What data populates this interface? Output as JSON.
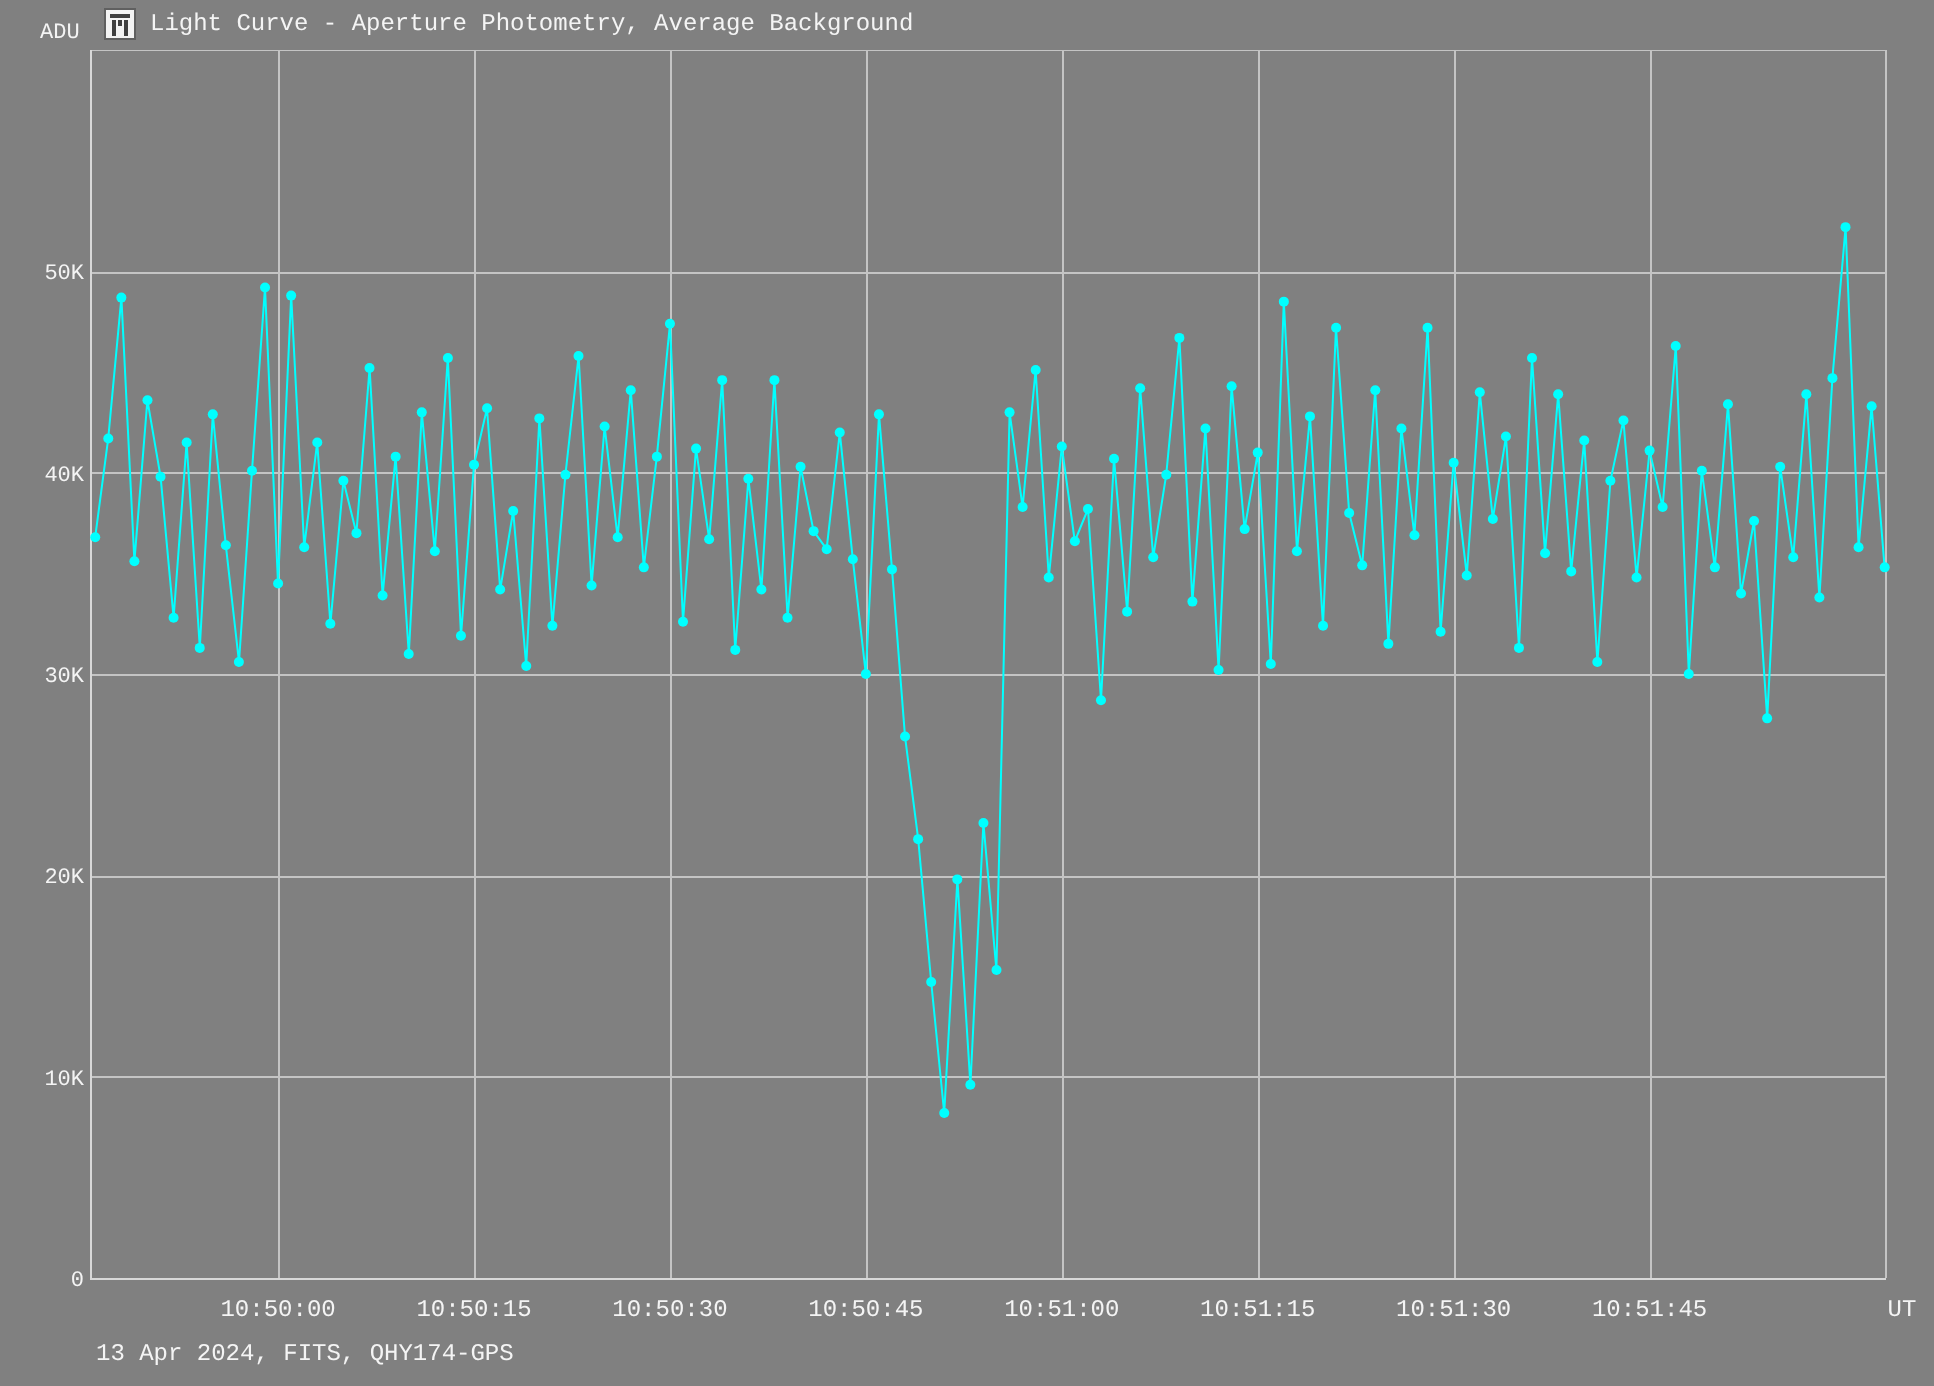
{
  "window": {
    "title": "Light Curve - Aperture Photometry, Average Background"
  },
  "chart": {
    "chart_data": {
      "type": "line",
      "xlabel": "UT",
      "ylabel": "ADU",
      "categories": [
        null,
        null,
        null,
        null,
        null,
        null,
        null,
        null,
        null,
        null,
        null,
        null,
        null,
        null,
        "10:50:00",
        null,
        null,
        null,
        null,
        null,
        null,
        null,
        null,
        null,
        null,
        null,
        null,
        null,
        null,
        "10:50:15",
        null,
        null,
        null,
        null,
        null,
        null,
        null,
        null,
        null,
        null,
        null,
        null,
        null,
        null,
        "10:50:30",
        null,
        null,
        null,
        null,
        null,
        null,
        null,
        null,
        null,
        null,
        null,
        null,
        null,
        null,
        "10:50:45",
        null,
        null,
        null,
        null,
        null,
        null,
        null,
        null,
        null,
        null,
        null,
        null,
        null,
        null,
        "10:51:00",
        null,
        null,
        null,
        null,
        null,
        null,
        null,
        null,
        null,
        null,
        null,
        null,
        null,
        null,
        "10:51:15",
        null,
        null,
        null,
        null,
        null,
        null,
        null,
        null,
        null,
        null,
        null,
        null,
        null,
        null,
        "10:51:30",
        null,
        null,
        null,
        null,
        null,
        null,
        null,
        null,
        null,
        null,
        null,
        null,
        null,
        null,
        "10:51:45",
        null,
        null,
        null,
        null,
        null,
        null,
        null,
        null,
        null,
        null,
        null,
        null,
        null,
        null,
        null,
        null,
        null,
        null
      ],
      "series": [
        {
          "color": "#00ffff",
          "marker": true,
          "values": [
            36800,
            41700,
            48700,
            35600,
            43600,
            39800,
            32800,
            41500,
            31300,
            42900,
            36400,
            30600,
            40100,
            49200,
            34500,
            48800,
            36300,
            41500,
            32500,
            39600,
            37000,
            45200,
            33900,
            40800,
            31000,
            43000,
            36100,
            45700,
            31900,
            40400,
            43200,
            34200,
            38100,
            30400,
            42700,
            32400,
            39900,
            45800,
            34400,
            42300,
            36800,
            44100,
            35300,
            40800,
            47400,
            32600,
            41200,
            36700,
            44600,
            31200,
            39700,
            34200,
            44600,
            32800,
            40300,
            37100,
            36200,
            42000,
            35700,
            30000,
            42900,
            35200,
            26900,
            21800,
            14700,
            8200,
            19800,
            9600,
            22600,
            15300,
            43000,
            38300,
            45100,
            34800,
            41300,
            36600,
            38200,
            28700,
            40700,
            33100,
            44200,
            35800,
            39900,
            46700,
            33600,
            42200,
            30200,
            44300,
            37200,
            41000,
            30500,
            48500,
            36100,
            42800,
            32400,
            47200,
            38000,
            35400,
            44100,
            31500,
            42200,
            36900,
            47200,
            32100,
            40500,
            34900,
            44000,
            37700,
            41800,
            31300,
            45700,
            36000,
            43900,
            35100,
            41600,
            30600,
            39600,
            42600,
            34800,
            41100,
            38300,
            46300,
            30000,
            40100,
            35300,
            43400,
            34000,
            37600,
            27800,
            40300,
            35800,
            43900,
            33800,
            44700,
            52200,
            36300,
            43300,
            35300
          ]
        }
      ],
      "ylim": [
        0,
        61000
      ],
      "grid": true,
      "yticks": [
        {
          "value": 0,
          "label": "0"
        },
        {
          "value": 10000,
          "label": "10K"
        },
        {
          "value": 20000,
          "label": "20K"
        },
        {
          "value": 30000,
          "label": "30K"
        },
        {
          "value": 40000,
          "label": "40K"
        },
        {
          "value": 50000,
          "label": "50K"
        }
      ]
    }
  },
  "status_bar": {
    "text": "13 Apr 2024, FITS, QHY174-GPS"
  }
}
